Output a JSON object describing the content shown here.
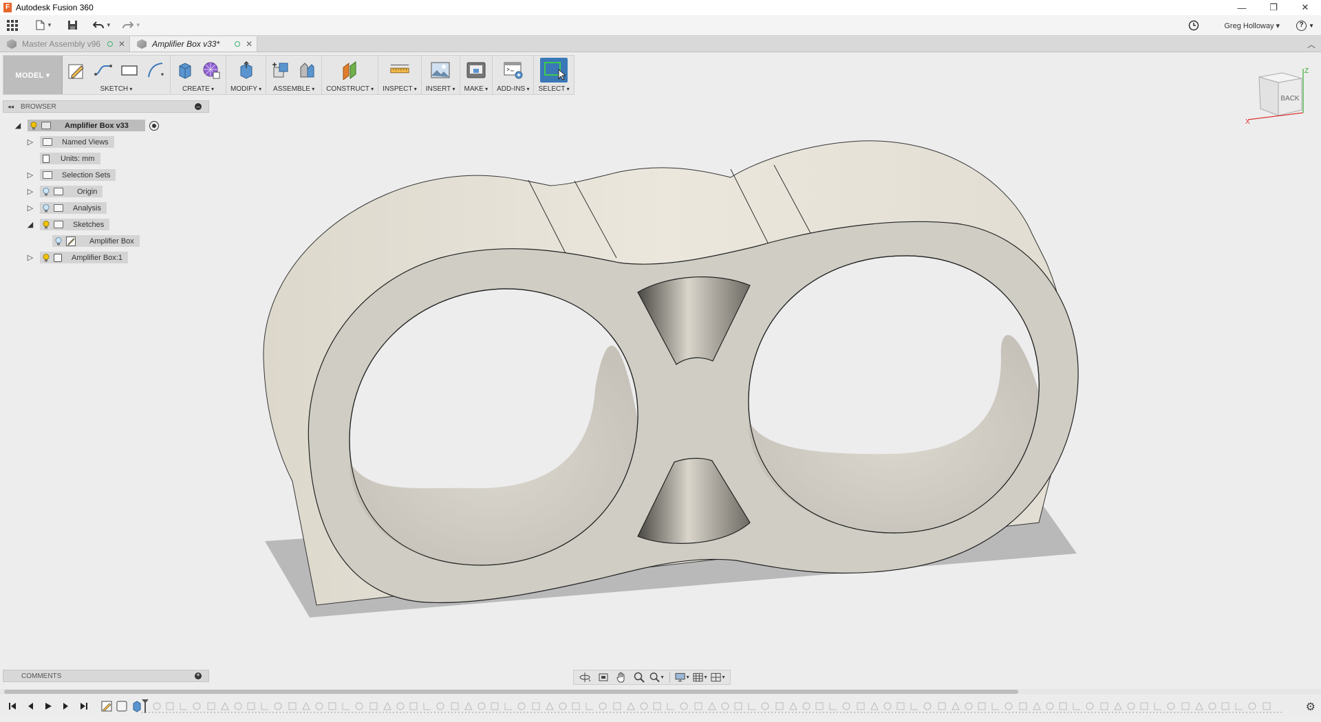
{
  "window": {
    "title": "Autodesk Fusion 360",
    "app_icon_letter": "F",
    "controls": {
      "minimize": "—",
      "restore": "❐",
      "close": "✕"
    }
  },
  "qat": {
    "user": "Greg Holloway ▾",
    "help": "?",
    "history_icon": "clock-icon"
  },
  "tabs": [
    {
      "label": "Master Assembly v96",
      "active": false
    },
    {
      "label": "Amplifier Box v33*",
      "active": true
    }
  ],
  "ribbon": {
    "workspace": "MODEL ▾",
    "groups": [
      "SKETCH",
      "CREATE",
      "MODIFY",
      "ASSEMBLE",
      "CONSTRUCT",
      "INSPECT",
      "INSERT",
      "MAKE",
      "ADD-INS",
      "SELECT"
    ]
  },
  "browser": {
    "header": "BROWSER",
    "root": "Amplifier Box v33",
    "items": [
      "Named Views",
      "Units: mm",
      "Selection Sets",
      "Origin",
      "Analysis",
      "Sketches",
      "Amplifier Box",
      "Amplifier Box:1"
    ]
  },
  "viewcube": {
    "face": "BACK",
    "axis_x": "X",
    "axis_z": "Z"
  },
  "comments": {
    "label": "COMMENTS",
    "add": "+"
  },
  "colors": {
    "model_face": "#cfcdc4",
    "model_side": "#e4e0d6",
    "shadow": "#b8b8b8",
    "accent_select": "#3a78b8",
    "bulb_on": "#f2c200"
  }
}
